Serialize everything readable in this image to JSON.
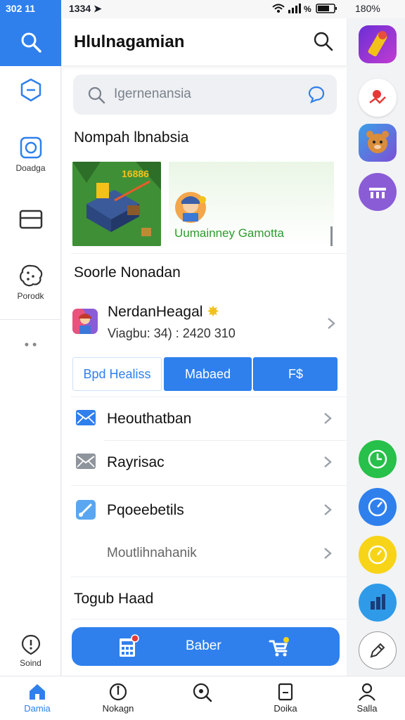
{
  "status_bar": {
    "left_time": "302 11",
    "time2": "1334",
    "battery_right": "180%"
  },
  "rail": {
    "items": [
      {
        "label": ""
      },
      {
        "label": "Doadga"
      },
      {
        "label": ""
      },
      {
        "label": "Porodk"
      }
    ],
    "more": "• •",
    "bottom_label": "Soind"
  },
  "header": {
    "title": "Hlulnagamian"
  },
  "search": {
    "placeholder": "Igernenansia"
  },
  "section1": {
    "title": "Nompah lbnabsia"
  },
  "banner": {
    "game_text": "16886",
    "caption": "Uumainney Gamotta"
  },
  "section2": {
    "title": "Soorle Nonadan"
  },
  "contact": {
    "name": "NerdanHeagal",
    "sub": "Viagbu: 34) : 2420 310"
  },
  "tabs": [
    {
      "label": "Bpd Healiss"
    },
    {
      "label": "Mabaed"
    },
    {
      "label": "F$"
    }
  ],
  "rows": [
    {
      "label": "Heouthatban",
      "icon": "mail-icon"
    },
    {
      "label": "Rayrisac",
      "icon": "mail-gray-icon"
    },
    {
      "label": "Pqoeebetils",
      "icon": "brush-icon"
    },
    {
      "label": "Moutlihnahanik",
      "icon": ""
    }
  ],
  "section3": {
    "title": "Togub Haad"
  },
  "action_button": {
    "label": "Baber"
  },
  "bottom_nav": [
    {
      "label": "Damia",
      "active": true
    },
    {
      "label": "Nokagn"
    },
    {
      "label": ""
    },
    {
      "label": "Doika"
    },
    {
      "label": "Salla"
    }
  ],
  "colors": {
    "accent": "#2f80ed",
    "green": "#2e9b2e",
    "fab_green": "#27c04a",
    "fab_yellow": "#f7d418"
  }
}
